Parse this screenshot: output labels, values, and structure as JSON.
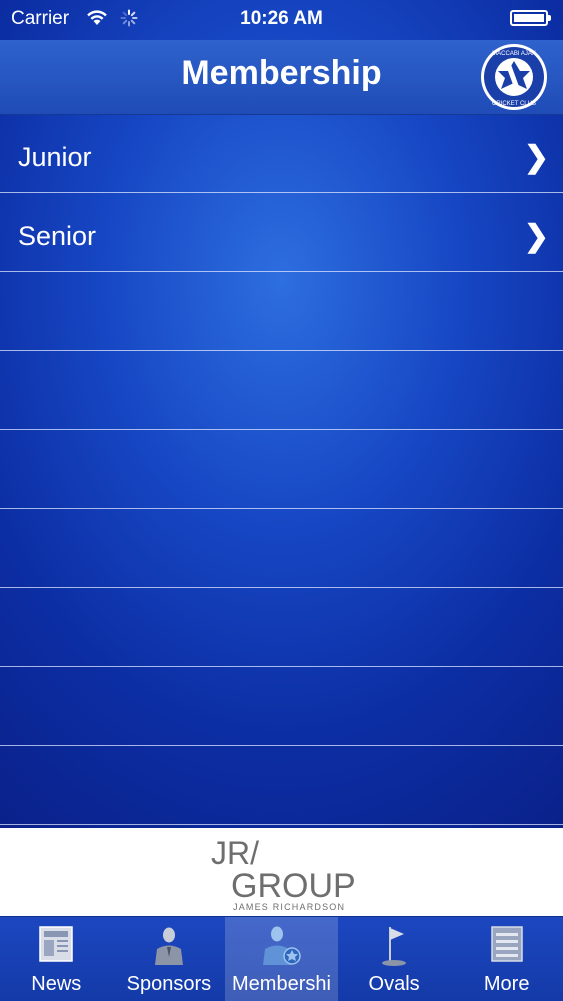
{
  "status_bar": {
    "carrier": "Carrier",
    "time": "10:26 AM"
  },
  "nav": {
    "title": "Membership",
    "logo_icon": "maccabi-ajax-cricket-club-crest",
    "logo_text_top": "MACCABI AJAX",
    "logo_text_bottom": "CRICKET CLUB"
  },
  "list": {
    "items": [
      {
        "label": "Junior",
        "chevron": "❯"
      },
      {
        "label": "Senior",
        "chevron": "❯"
      }
    ],
    "empty_rows": 7
  },
  "sponsor": {
    "line1": "JR/",
    "line2": "GROUP",
    "line3": "JAMES RICHARDSON"
  },
  "tabs": [
    {
      "label": "News",
      "icon": "newspaper-icon"
    },
    {
      "label": "Sponsors",
      "icon": "person-suit-icon"
    },
    {
      "label": "Membershi",
      "icon": "member-badge-icon",
      "active": true
    },
    {
      "label": "Ovals",
      "icon": "flag-icon"
    },
    {
      "label": "More",
      "icon": "list-icon"
    }
  ],
  "colors": {
    "accent": "#1f4cb7",
    "background": "#0c2ea4",
    "text": "#ffffff"
  }
}
